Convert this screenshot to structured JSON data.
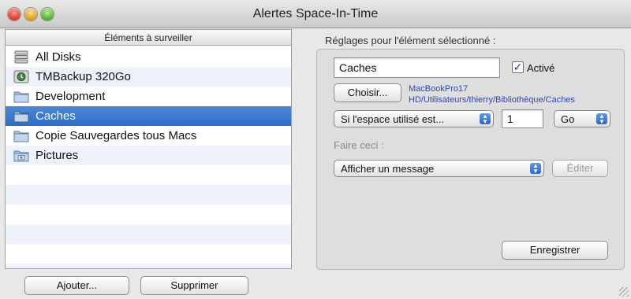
{
  "window": {
    "title": "Alertes Space-In-Time"
  },
  "list": {
    "header": "Éléments à surveiller",
    "items": [
      {
        "label": "All Disks",
        "icon": "disk-stack-icon"
      },
      {
        "label": "TMBackup 320Go",
        "icon": "time-machine-disk-icon"
      },
      {
        "label": "Development",
        "icon": "folder-icon"
      },
      {
        "label": "Caches",
        "icon": "folder-icon",
        "selected": true
      },
      {
        "label": "Copie Sauvegardes tous Macs",
        "icon": "folder-icon"
      },
      {
        "label": "Pictures",
        "icon": "pictures-folder-icon"
      }
    ]
  },
  "buttons": {
    "add": "Ajouter...",
    "remove": "Supprimer"
  },
  "settings": {
    "heading": "Réglages pour l'élément sélectionné :",
    "name_value": "Caches",
    "enabled_label": "Activé",
    "enabled": true,
    "choose_button": "Choisir...",
    "path": "MacBookPro17 HD/Utilisateurs/thierry/Bibliothèque/Caches",
    "condition_popup": "Si l'espace utilisé est...",
    "threshold_value": "1",
    "unit_popup": "Go",
    "do_label": "Faire ceci :",
    "action_popup": "Afficher un message",
    "edit_button": "Éditer",
    "save_button": "Enregistrer"
  },
  "colors": {
    "selection": "#3a78d0",
    "path_text": "#2c48b8"
  }
}
